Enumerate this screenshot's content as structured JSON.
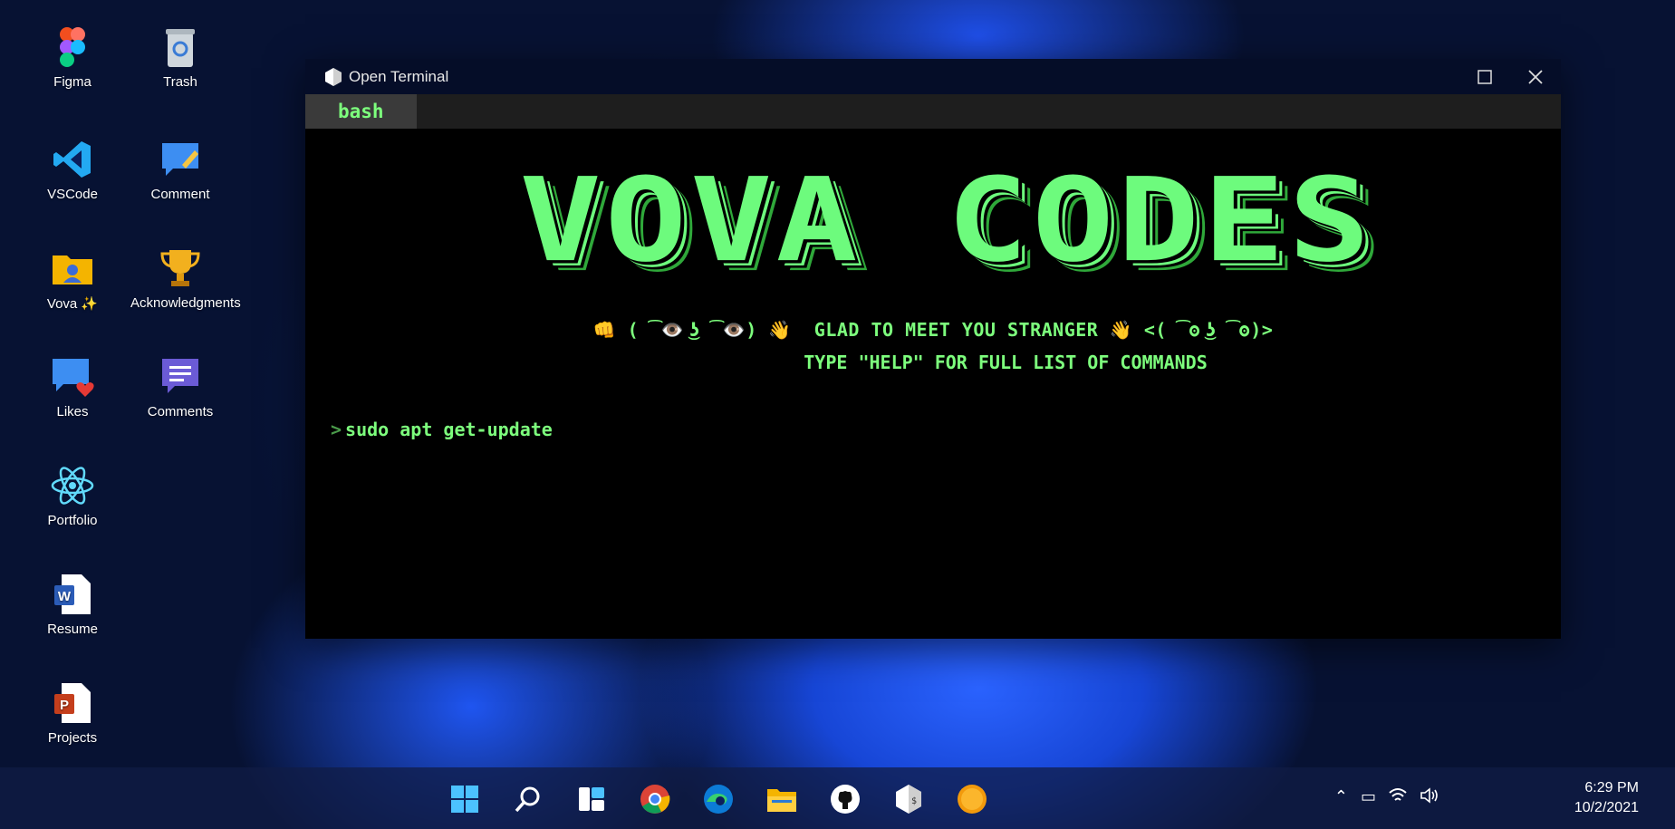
{
  "desktop": {
    "icons": [
      {
        "label": "Figma"
      },
      {
        "label": "Trash"
      },
      {
        "label": "VSCode"
      },
      {
        "label": "Comment"
      },
      {
        "label": "Vova ✨"
      },
      {
        "label": "Acknowledgments"
      },
      {
        "label": "Likes"
      },
      {
        "label": "Comments"
      },
      {
        "label": "Portfolio"
      },
      {
        "label": "Resume"
      },
      {
        "label": "Projects"
      }
    ]
  },
  "window": {
    "title": "Open Terminal",
    "tab": "bash",
    "banner": "VOVA CODES",
    "greeting": {
      "left_emoji": "👊",
      "left_face": "( ͡👁️ ͜ʖ ͡👁️)",
      "wave1": "👋",
      "text": "GLAD TO MEET YOU STRANGER",
      "wave2": "👋",
      "right_face": "<( ͡ʘ ͜ʖ ͡ʘ)>"
    },
    "hint": "TYPE \"HELP\" FOR FULL LIST OF COMMANDS",
    "prompt_symbol": ">",
    "command": "sudo apt get-update"
  },
  "taskbar": {
    "apps": [
      "start-icon",
      "search-icon",
      "widgets-icon",
      "chrome-icon",
      "edge-icon",
      "folder-icon",
      "github-icon",
      "terminal-icon",
      "sun-icon"
    ],
    "time": "6:29 PM",
    "date": "10/2/2021"
  },
  "colors": {
    "terminal_green": "#7dff7d",
    "titlebar": "#050d28"
  }
}
